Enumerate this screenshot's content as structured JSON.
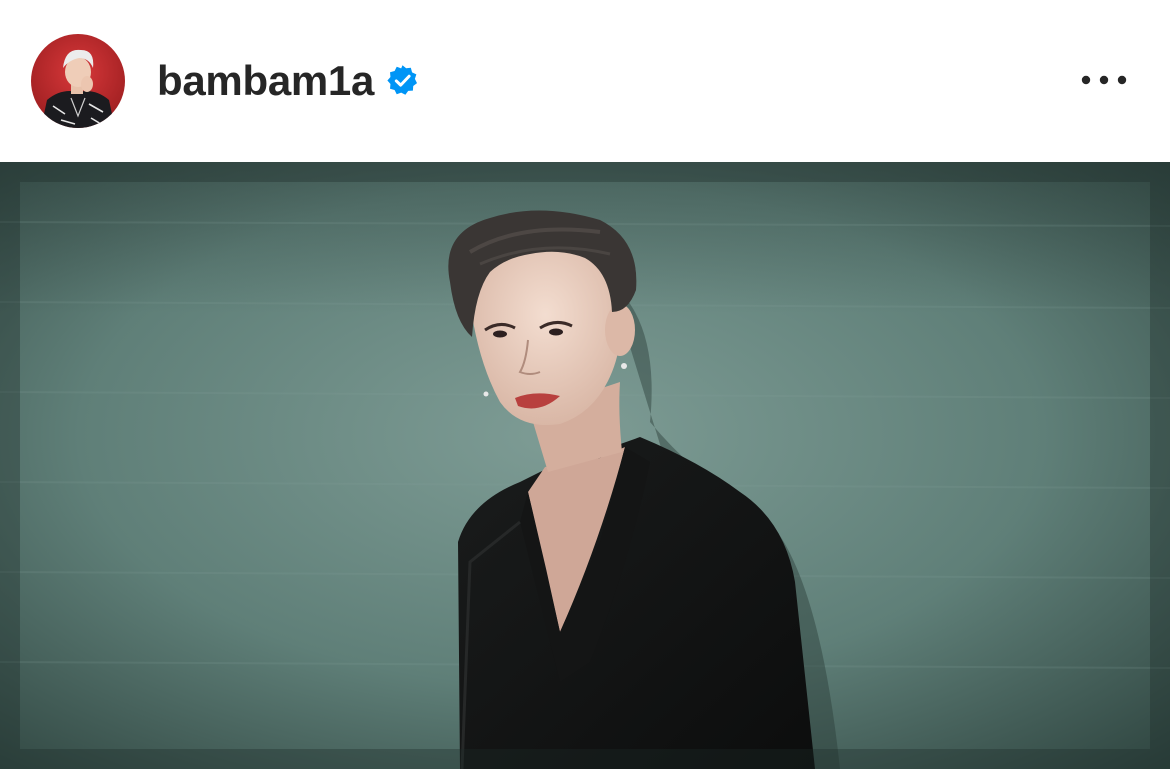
{
  "post": {
    "username": "bambam1a",
    "verified": true,
    "icons": {
      "verified": "verified-badge-icon",
      "more": "more-options-icon",
      "avatar": "profile-avatar"
    },
    "colors": {
      "verified_blue": "#0095f6",
      "username_text": "#262626",
      "photo_background": "#5f7f78",
      "avatar_ring_bg": "#c0282a"
    }
  }
}
